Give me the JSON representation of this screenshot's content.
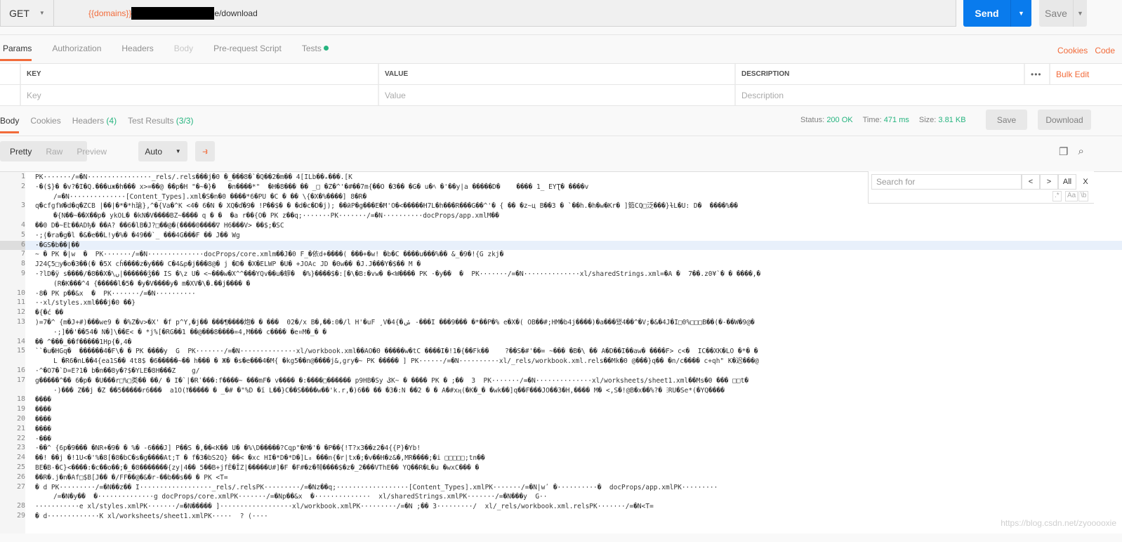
{
  "request": {
    "method": "GET",
    "url_variable": "{{domains}}",
    "url_suffix": "e/download",
    "send_label": "Send",
    "save_label": "Save"
  },
  "request_tabs": [
    {
      "label": "Params"
    },
    {
      "label": "Authorization"
    },
    {
      "label": "Headers"
    },
    {
      "label": "Body"
    },
    {
      "label": "Pre-request Script"
    },
    {
      "label": "Tests"
    }
  ],
  "request_links": {
    "cookies": "Cookies",
    "code": "Code"
  },
  "params": {
    "headers": {
      "key": "KEY",
      "value": "VALUE",
      "description": "DESCRIPTION"
    },
    "placeholders": {
      "key": "Key",
      "value": "Value",
      "description": "Description"
    },
    "more": "•••",
    "bulk_edit": "Bulk Edit"
  },
  "response_tabs": [
    {
      "label": "Body"
    },
    {
      "label": "Cookies"
    },
    {
      "label": "Headers",
      "count": "(4)"
    },
    {
      "label": "Test Results",
      "count": "(3/3)"
    }
  ],
  "response_status": {
    "status_label": "Status:",
    "status": "200 OK",
    "time_label": "Time:",
    "time": "471 ms",
    "size_label": "Size:",
    "size": "3.81 KB",
    "save": "Save",
    "download": "Download"
  },
  "format": {
    "pretty": "Pretty",
    "raw": "Raw",
    "preview": "Preview",
    "mode": "Auto"
  },
  "search": {
    "placeholder": "Search for",
    "prev": "<",
    "next": ">",
    "all": "All",
    "close": "X",
    "regex": ".*",
    "case": "Aa",
    "word": "\\b"
  },
  "colors": {
    "accent": "#f26b3a",
    "send": "#097bed",
    "success": "#26b47f"
  },
  "body_lines": [
    {
      "n": "1",
      "rows": [
        "PK·······/=�N················_rels/.rels���j�0 �_���8�`�Q��2�m�� 4[ILb��ₔ���.[K"
      ]
    },
    {
      "n": "2",
      "rows": [
        "·�($}� �v?�I�Q.���uж�h��� x>=��@ ��p�H \"�~�}�   �n����*\"  �H�8��� �� _□ �Z�^'�#��7m{��O �3�� �G� u�ﾍ �'��y|a �����D�    ���� 1_ EYƮ� ����v",
        "/=�N··············[Content_Types].xml�S�n�0 ����*6�PU �C � �� \\{�X�%����] 8�R�"
      ]
    },
    {
      "n": "3",
      "rows": [
        "q�cfgfW�d�q�ZCB |��|�*�*h瑲},^�{Va�^K <4� 6�N � XQ�ď�9� !P��$� � �d�c�D�j); ��ӣP�g���E�M'O�<�����H7L�h���R���G��^'� { �� �z~ц B��3 � `��h.�h�w�Kr� ]筎CQ□泛���}ɫL�U: D�  ����%��",
        "�{N��~��X��p� ykOL� �kN�V����BZ~���� q � �  �a r��{O� PK z��q;·······PK·······/=�N··········docProps/app.xmlM��"
      ]
    },
    {
      "n": "4",
      "rows": [
        "��0 D�~Eէ��ADђ� ��A? ��6�lB�J?□��@�(����0����∇ H6���V> ��$;�SC"
      ]
    },
    {
      "n": "5",
      "rows": [
        "·;̣(�ra�g�l �&�e��L!y�%� �49��`_ ���4G���F �� J�� Wg"
      ]
    },
    {
      "n": "6",
      "rows": [
        "·�GS�b��|��"
      ]
    },
    {
      "n": "7",
      "rows": [
        "~ � PK �|w  �  PK·······/=�N··············docProps/core.xmlm��J�0 F_�依d+����( ���+�w! �b�C ����u���%�� &_�9�!{G zkj�"
      ]
    },
    {
      "n": "8",
      "rows": [
        "J24Ç5□y�o�3��(� �5X cĥ����z�y��� C�4&p�j���8@� j �D� �X�ELWP �U� +JOAc JD �0w�� �J.J���Y�$�� M �"
      ]
    },
    {
      "n": "9",
      "rows": [
        "·?lD�ÿ s����/�8��X�\\ࢽ|������ǯ�� IS �\\z U� <~���w�X^^���YQv��u�蝷�  �%}����$�:[�\\�B:�vw� �<W���� PK ·�y��  �  PK·······/=�N··············xl/sharedStrings.xml=�A �  7��.z0¥`� � ����,�",
        "(R�K���^4 {�����l�5� �y�V����y� m�XV�\\�.��j���� �"
      ]
    },
    {
      "n": "10",
      "rows": [
        "·8� PK p��&x  �  PK·······/=�N··········"
      ]
    },
    {
      "n": "11",
      "rows": [
        "··xl/styles.xml���j�0 ��}"
      ]
    },
    {
      "n": "12",
      "rows": [
        "�{�ć ��"
      ]
    },
    {
      "n": "13",
      "rows": [
        ")=7�^ {m�J+#)���we9 � �%Z�v>�X' �f p^Y,�j�� ���¶����炮� � ���  02�/x B�,��:0�/l H'�uF ¸V�4{�ݭ -���I ���9��� �*��P�% e�X�( OB��#;HM�b4j����)�a���됐4��^�V;�&�4J�I□0%□□□B��(�-��W�9@� ",
        "·;]��'��54� N�]\\��E< � *j%[�RG��1 ��@���8����=4,M��� c���� �e¤M�_� �"
      ]
    },
    {
      "n": "14",
      "rows": [
        "�� ^���_��f�����1Hp{�,4�"
      ]
    },
    {
      "n": "15",
      "rows": [
        "``�u�HGq�  ������4�F\\� � PK ����y  G  PK·······/=�N··············xl/workbook.xml��AO�0 �����w�tC ����I�!1�{��Fk��    ?��S�#'��= ~��� �B�\\ �� A�D��I��aw� ����F> c<�  IC��XK�LO �*� �",
        "L �R6�nL��4{ea1S�� 4t8$ �6�����~�� h��� � Ж� �s�e���4�M{ �kg5��n@����j&,gry�~ PK ����� ] PK······/=�N··········xl/_rels/workbook.xml.rels��Mk�0 @���}q�� �n/c���� c+qh\" K�迟���@"
      ]
    },
    {
      "n": "16",
      "rows": [
        "·^�O7�`D=E?1� b�n��8y�?$�YLE�8H���Z    g/"
      ]
    },
    {
      "n": "17",
      "rows": [
        "g�����^�� 6�p� �U���r□%□类�� ��/ � I�`|�Rʿ���:f����~ ���mF� v���� �:����□������ p9HB�Sy ݣK~ � ���� PK � ;��  3  PK·······/=�N··············xl/worksheets/sheet1.xml��Ms�0 ��� □□t�",
        "·)��� Z��j �Z ��5�����r6���  a1O(ߌ����� � _�# �\"%D �ï L��}C��S����w��'k.r,�)6�� �� �3�:N ��2 � � A�#xӊ(�K�_� �wk��]q��F���JO��3�H,���� M� <,S�!@B�x��%?� ⵗRU�Se*(�YQ����"
      ]
    },
    {
      "n": "18",
      "rows": [
        "����"
      ]
    },
    {
      "n": "19",
      "rows": [
        "����"
      ]
    },
    {
      "n": "20",
      "rows": [
        "����"
      ]
    },
    {
      "n": "21",
      "rows": [
        "����"
      ]
    },
    {
      "n": "22",
      "rows": [
        "·���"
      ]
    },
    {
      "n": "23",
      "rows": [
        "·��^ {6p�9��� �NR+�9� � %� -6���J] P��S �,��<K�� U� �%\\D�����?Cqp\"�M�'� �P��{!T?x3��z2�4{{P}�Yb!"
      ]
    },
    {
      "n": "24",
      "rows": [
        "��! ��j �!1U<�'%�8[�8�bC�s�g����At;T � f�3�bS2Q} ��< �xc HI�*D�*D�]L₈ ���n{�r|tx�;�v��H�z&�,MR����;�i □□□□□;tn��"
      ]
    },
    {
      "n": "25",
      "rows": [
        "BE�B-�C}<����:�c��o��;�_�8�������{zy|4�� 5��B+jfÈ�ÎZ|�����U#]�F �F#�z�췌����$�z�_2���VThE�� YQ��R�L�u �wxC��� �"
      ]
    },
    {
      "n": "26",
      "rows": [
        "��R�.j�n�Af□$B[J�� �/FF��@�&�r-��b��s�� � PK <T="
      ]
    },
    {
      "n": "27",
      "rows": [
        "� d PK·········/=�N��z�� I··················_rels/.relsPK·········/=�Nz��q;··················[Content_Types].xmlPK·······/=�N|wʹ �··········�  docProps/app.xmlPK·········",
        "/=�N�y��  �··············g docProps/core.xmlPK·······/=�Np��&x  �··············  xl/sharedStrings.xmlPK·······/=�N���y  G··"
      ]
    },
    {
      "n": "28",
      "rows": [
        "···········e xl/styles.xmlPK·······/=�N����� ]··················xl/workbook.xmlPK·········/=�N ;�� 3·········/  xl/_rels/workbook.xml.relsPK·······/=�N<T="
      ]
    },
    {
      "n": "29",
      "rows": [
        "� d·············K xl/worksheets/sheet1.xmlPK·····  ? (····"
      ]
    }
  ],
  "watermark": "https://blog.csdn.net/zyooooxie"
}
